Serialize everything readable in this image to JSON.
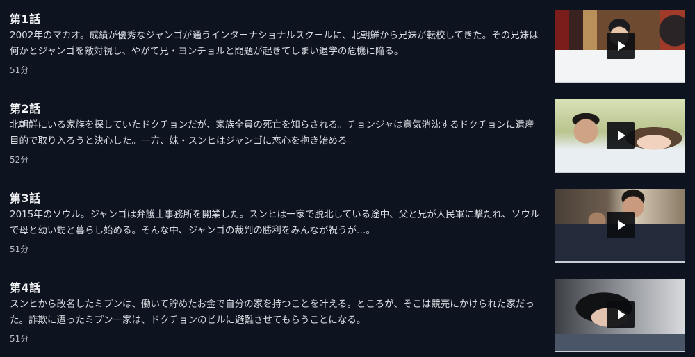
{
  "episodes": [
    {
      "title": "第1話",
      "description": "2002年のマカオ。成績が優秀なジャンゴが通うインターナショナルスクールに、北朝鮮から兄妹が転校してきた。その兄妹は何かとジャンゴを敵対視し、やがて兄・ヨンチョルと問題が起きてしまい退学の危機に陥る。",
      "duration": "51分",
      "thumbnail_icon": "play-icon"
    },
    {
      "title": "第2話",
      "description": "北朝鮮にいる家族を探していたドクチョンだが、家族全員の死亡を知らされる。チョンジャは意気消沈するドクチョンに遺産目的で取り入ろうと決心した。一方、妹・スンヒはジャンゴに恋心を抱き始める。",
      "duration": "52分",
      "thumbnail_icon": "play-icon"
    },
    {
      "title": "第3話",
      "description": "2015年のソウル。ジャンゴは弁護士事務所を開業した。スンヒは一家で脱北している途中、父と兄が人民軍に撃たれ、ソウルで母と幼い甥と暮らし始める。そんな中、ジャンゴの裁判の勝利をみんなが祝うが…。",
      "duration": "51分",
      "thumbnail_icon": "play-icon"
    },
    {
      "title": "第4話",
      "description": "スンヒから改名したミプンは、働いて貯めたお金で自分の家を持つことを叶える。ところが、そこは競売にかけられた家だった。詐欺に遭ったミプン一家は、ドクチョンのビルに避難させてもらうことになる。",
      "duration": "51分",
      "thumbnail_icon": "play-icon"
    }
  ],
  "colors": {
    "background": "#0e141f",
    "title_text": "#f2f3f5",
    "body_text": "#d9dce2",
    "meta_text": "#b7bcc6",
    "play_button_bg": "#0a0c10",
    "play_icon": "#ffffff"
  }
}
